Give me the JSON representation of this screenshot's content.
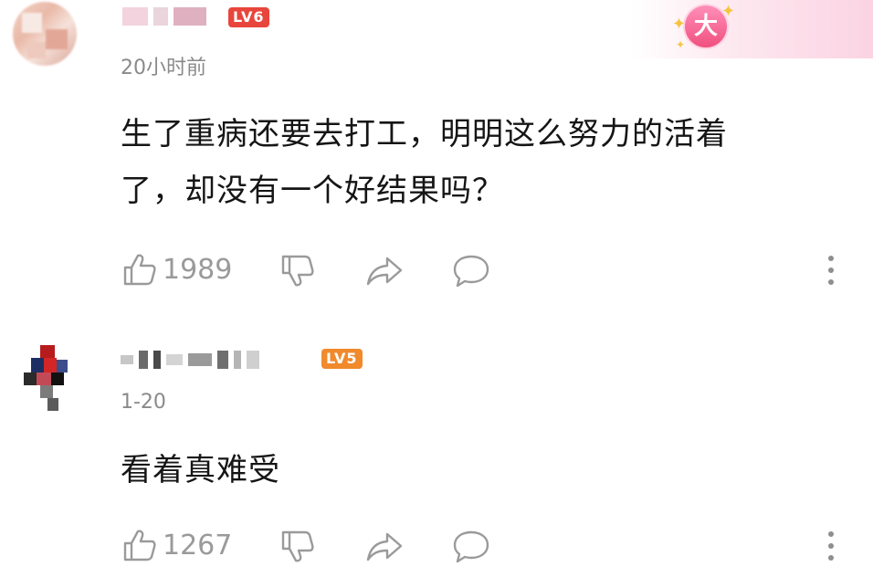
{
  "comments": [
    {
      "level": "LV6",
      "time": "20小时前",
      "text_lines": [
        "生了重病还要去打工，明明这么努力的活着",
        "了，却没有一个好结果吗？"
      ],
      "like_count": "1989",
      "badge": "大"
    },
    {
      "level": "LV5",
      "time": "1-20",
      "text_lines": [
        "看着真难受"
      ],
      "like_count": "1267"
    }
  ],
  "colors": {
    "level6_badge": "#e8453c",
    "level5_badge": "#f08a2c",
    "icon_gray": "#9a9a9a",
    "timestamp_gray": "#8a8a8a"
  },
  "icons": [
    "like-icon",
    "dislike-icon",
    "share-icon",
    "reply-icon",
    "more-icon"
  ]
}
